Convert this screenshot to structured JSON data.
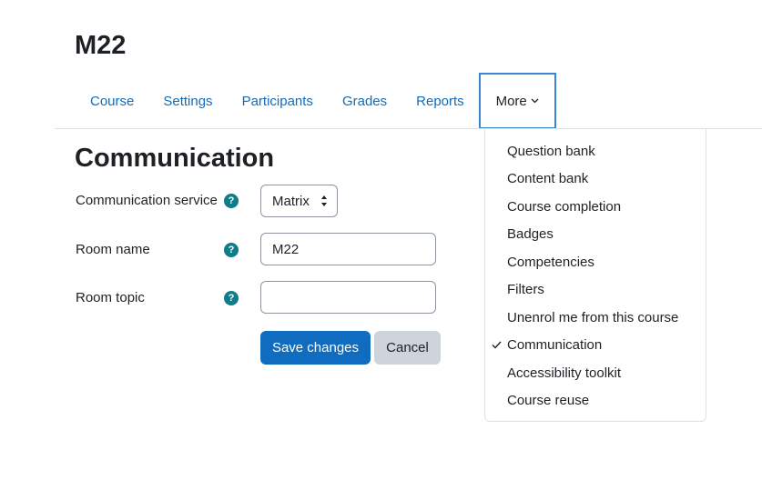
{
  "course": {
    "title": "M22"
  },
  "nav": {
    "items": [
      {
        "label": "Course"
      },
      {
        "label": "Settings"
      },
      {
        "label": "Participants"
      },
      {
        "label": "Grades"
      },
      {
        "label": "Reports"
      }
    ],
    "more_label": "More"
  },
  "page": {
    "title": "Communication"
  },
  "form": {
    "service_label": "Communication service",
    "service_value": "Matrix",
    "room_name_label": "Room name",
    "room_name_value": "M22",
    "room_topic_label": "Room topic",
    "room_topic_value": "",
    "help_glyph": "?",
    "save_label": "Save changes",
    "cancel_label": "Cancel"
  },
  "dropdown": {
    "items": [
      {
        "label": "Question bank"
      },
      {
        "label": "Content bank"
      },
      {
        "label": "Course completion"
      },
      {
        "label": "Badges"
      },
      {
        "label": "Competencies"
      },
      {
        "label": "Filters"
      },
      {
        "label": "Unenrol me from this course"
      },
      {
        "label": "Communication",
        "selected": true
      },
      {
        "label": "Accessibility toolkit"
      },
      {
        "label": "Course reuse"
      }
    ]
  },
  "colors": {
    "link": "#0f6cbf",
    "primary": "#0f6cbf",
    "help_icon": "#0f7c8a",
    "focus_border": "#3b86cf"
  },
  "icons": {
    "help": "question-circle-icon",
    "more": "chevron-down-icon",
    "select": "sort-arrows-icon",
    "selected": "check-icon"
  }
}
